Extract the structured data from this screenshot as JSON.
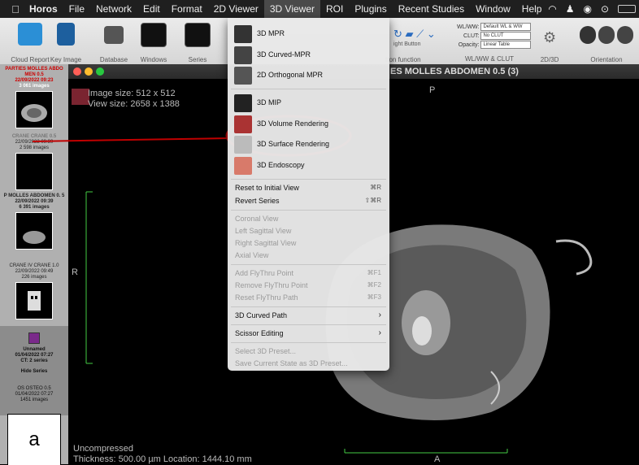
{
  "menubar": {
    "app": "Horos",
    "items": [
      "File",
      "Network",
      "Edit",
      "Format",
      "2D Viewer",
      "3D Viewer",
      "ROI",
      "Plugins",
      "Recent Studies",
      "Window",
      "Help"
    ],
    "active": "3D Viewer"
  },
  "toolbar": {
    "labels": [
      "Cloud Report",
      "Key Image",
      "Database",
      "Windows",
      "Series"
    ],
    "right_labels": [
      "tton function",
      "WL/WW & CLUT",
      "2D/3D",
      "Orientation"
    ],
    "right_button_text": "ight Button",
    "wlww": {
      "label": "WL/WW:",
      "value": "Default WL & WW"
    },
    "clut": {
      "label": "CLUT:",
      "value": "No CLUT"
    },
    "opacity": {
      "label": "Opacity:",
      "value": "Linear Table"
    }
  },
  "window_title": "ES MOLLES ABDOMEN 0.5 (3)",
  "sidebar": {
    "series": [
      {
        "title": "PARTIES MOLLES ABDO MEN 0.5",
        "date": "22/09/2022 09:23",
        "count": "3 061 images"
      },
      {
        "title": "CRANE CRANE 0.5",
        "date": "22/09/2022 09:39",
        "count": "2 598 images"
      },
      {
        "title": "P MOLLES ABDOMEN 0. 5",
        "date": "22/09/2022 09:39",
        "count": "6 391 images"
      },
      {
        "title": "CRANE IV CRANE 1.0",
        "date": "22/09/2022 09:49",
        "count": "226 images"
      }
    ],
    "study": {
      "name": "Unnamed",
      "date": "01/04/2022 07:27",
      "info": "CT: 2 series",
      "hide": "Hide Series"
    },
    "last": {
      "title": "OS OSTEO 0.5",
      "date": "01/04/2022 07:27",
      "count": "1451 images"
    }
  },
  "viewer": {
    "image_size": "Image size: 512 x 512",
    "view_size": "View size: 2658 x 1388",
    "orient_top": "P",
    "orient_left": "R",
    "orient_bottom": "A",
    "compression": "Uncompressed",
    "thickness": "Thickness: 500.00 µm Location: 1444.10 mm"
  },
  "menu": {
    "top_items": [
      "3D MPR",
      "3D Curved-MPR",
      "2D Orthogonal MPR",
      "3D MIP",
      "3D Volume Rendering",
      "3D Surface Rendering",
      "3D Endoscopy"
    ],
    "reset": {
      "label": "Reset to Initial View",
      "shortcut": "⌘R"
    },
    "revert": {
      "label": "Revert Series",
      "shortcut": "⇧⌘R"
    },
    "views": [
      "Coronal View",
      "Left Sagittal View",
      "Right Sagittal View",
      "Axial View"
    ],
    "flythru": [
      {
        "label": "Add FlyThru Point",
        "shortcut": "⌘F1"
      },
      {
        "label": "Remove FlyThru Point",
        "shortcut": "⌘F2"
      },
      {
        "label": "Reset FlyThru Path",
        "shortcut": "⌘F3"
      }
    ],
    "curved_path": "3D Curved Path",
    "scissor": "Scissor Editing",
    "preset_select": "Select 3D Preset...",
    "preset_save": "Save Current State as 3D Preset..."
  },
  "annotation": {
    "label": "a",
    "color": "#c00000"
  }
}
